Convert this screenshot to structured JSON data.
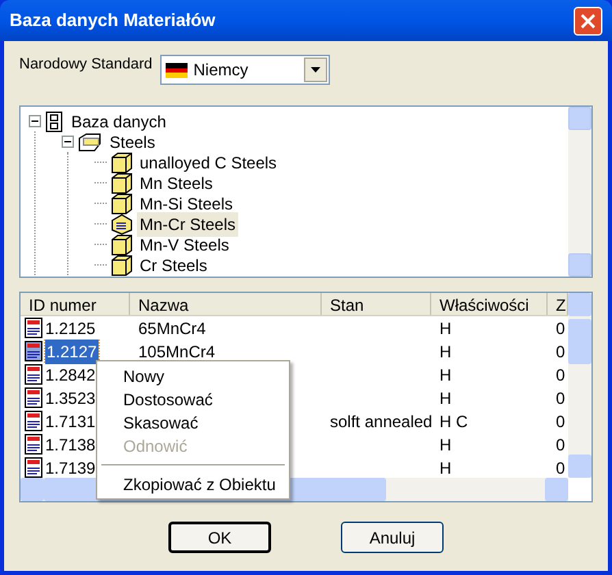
{
  "window": {
    "title": "Baza danych Materiałów"
  },
  "standard": {
    "label": "Narodowy Standard",
    "value": "Niemcy"
  },
  "tree": [
    {
      "label": "Baza danych",
      "kind": "database",
      "expanded": true,
      "selected": false,
      "children": [
        {
          "label": "Steels",
          "kind": "folder",
          "expanded": true,
          "selected": false,
          "children": [
            {
              "label": "unalloyed C Steels",
              "kind": "group",
              "selected": false
            },
            {
              "label": "Mn Steels",
              "kind": "group",
              "selected": false
            },
            {
              "label": "Mn-Si Steels",
              "kind": "group",
              "selected": false
            },
            {
              "label": "Mn-Cr Steels",
              "kind": "group",
              "selected": true
            },
            {
              "label": "Mn-V Steels",
              "kind": "group",
              "selected": false
            },
            {
              "label": "Cr Steels",
              "kind": "group",
              "selected": false
            }
          ]
        }
      ]
    }
  ],
  "table": {
    "columns": [
      "ID numer",
      "Nazwa",
      "Stan",
      "Właściwości",
      "Z"
    ],
    "rows": [
      {
        "cells": [
          "1.2125",
          "65MnCr4",
          "",
          "H",
          "0"
        ],
        "selected": false
      },
      {
        "cells": [
          "1.2127",
          "105MnCr4",
          "",
          "H",
          "0"
        ],
        "selected": true
      },
      {
        "cells": [
          "1.2842",
          "",
          "",
          "H",
          "0"
        ],
        "selected": false
      },
      {
        "cells": [
          "1.3523",
          "",
          "",
          "H",
          "0"
        ],
        "selected": false
      },
      {
        "cells": [
          "1.7131",
          "",
          "solft annealed",
          "H C",
          "0"
        ],
        "selected": false
      },
      {
        "cells": [
          "1.7138",
          "",
          "",
          "H",
          "0"
        ],
        "selected": false
      },
      {
        "cells": [
          "1.7139",
          "",
          "",
          "H",
          "0"
        ],
        "selected": false
      }
    ]
  },
  "context_menu": [
    {
      "kind": "item",
      "label": "Nowy",
      "disabled": false
    },
    {
      "kind": "item",
      "label": "Dostosować",
      "disabled": false
    },
    {
      "kind": "item",
      "label": "Skasować",
      "disabled": false
    },
    {
      "kind": "item",
      "label": "Odnowić",
      "disabled": true
    },
    {
      "kind": "separator"
    },
    {
      "kind": "item",
      "label": "Zkopiować z Obiektu",
      "disabled": false
    }
  ],
  "buttons": [
    "OK",
    "Anuluj"
  ]
}
